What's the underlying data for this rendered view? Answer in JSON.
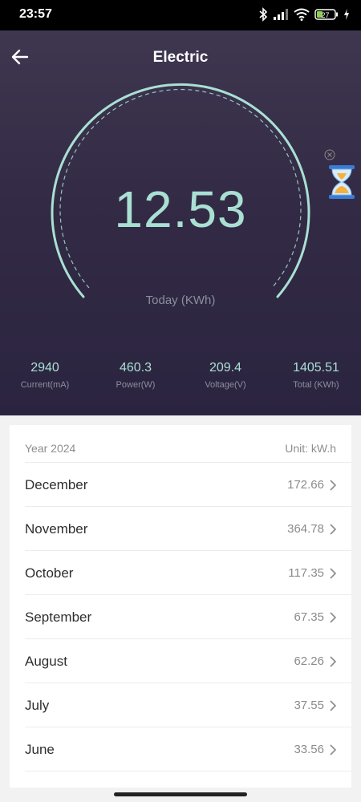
{
  "status_bar": {
    "time": "23:57",
    "battery": "27",
    "icons": [
      "bluetooth-icon",
      "signal-icon",
      "wifi-icon",
      "battery-icon",
      "charging-icon"
    ]
  },
  "header": {
    "title": "Electric",
    "back_icon": "arrow-left-icon"
  },
  "gauge": {
    "value": "12.53",
    "label": "Today (KWh)",
    "color": "#a9e0d3"
  },
  "stats": [
    {
      "value": "2940",
      "label": "Current(mA)"
    },
    {
      "value": "460.3",
      "label": "Power(W)"
    },
    {
      "value": "209.4",
      "label": "Voltage(V)"
    },
    {
      "value": "1405.51",
      "label": "Total (KWh)"
    }
  ],
  "history": {
    "year": "Year 2024",
    "unit": "Unit: kW.h",
    "rows": [
      {
        "month": "December",
        "value": "172.66"
      },
      {
        "month": "November",
        "value": "364.78"
      },
      {
        "month": "October",
        "value": "117.35"
      },
      {
        "month": "September",
        "value": "67.35"
      },
      {
        "month": "August",
        "value": "62.26"
      },
      {
        "month": "July",
        "value": "37.55"
      },
      {
        "month": "June",
        "value": "33.56"
      }
    ]
  },
  "colors": {
    "hero_top": "#3f3650",
    "hero_bottom": "#2b2440",
    "accent": "#a9e0d3"
  }
}
